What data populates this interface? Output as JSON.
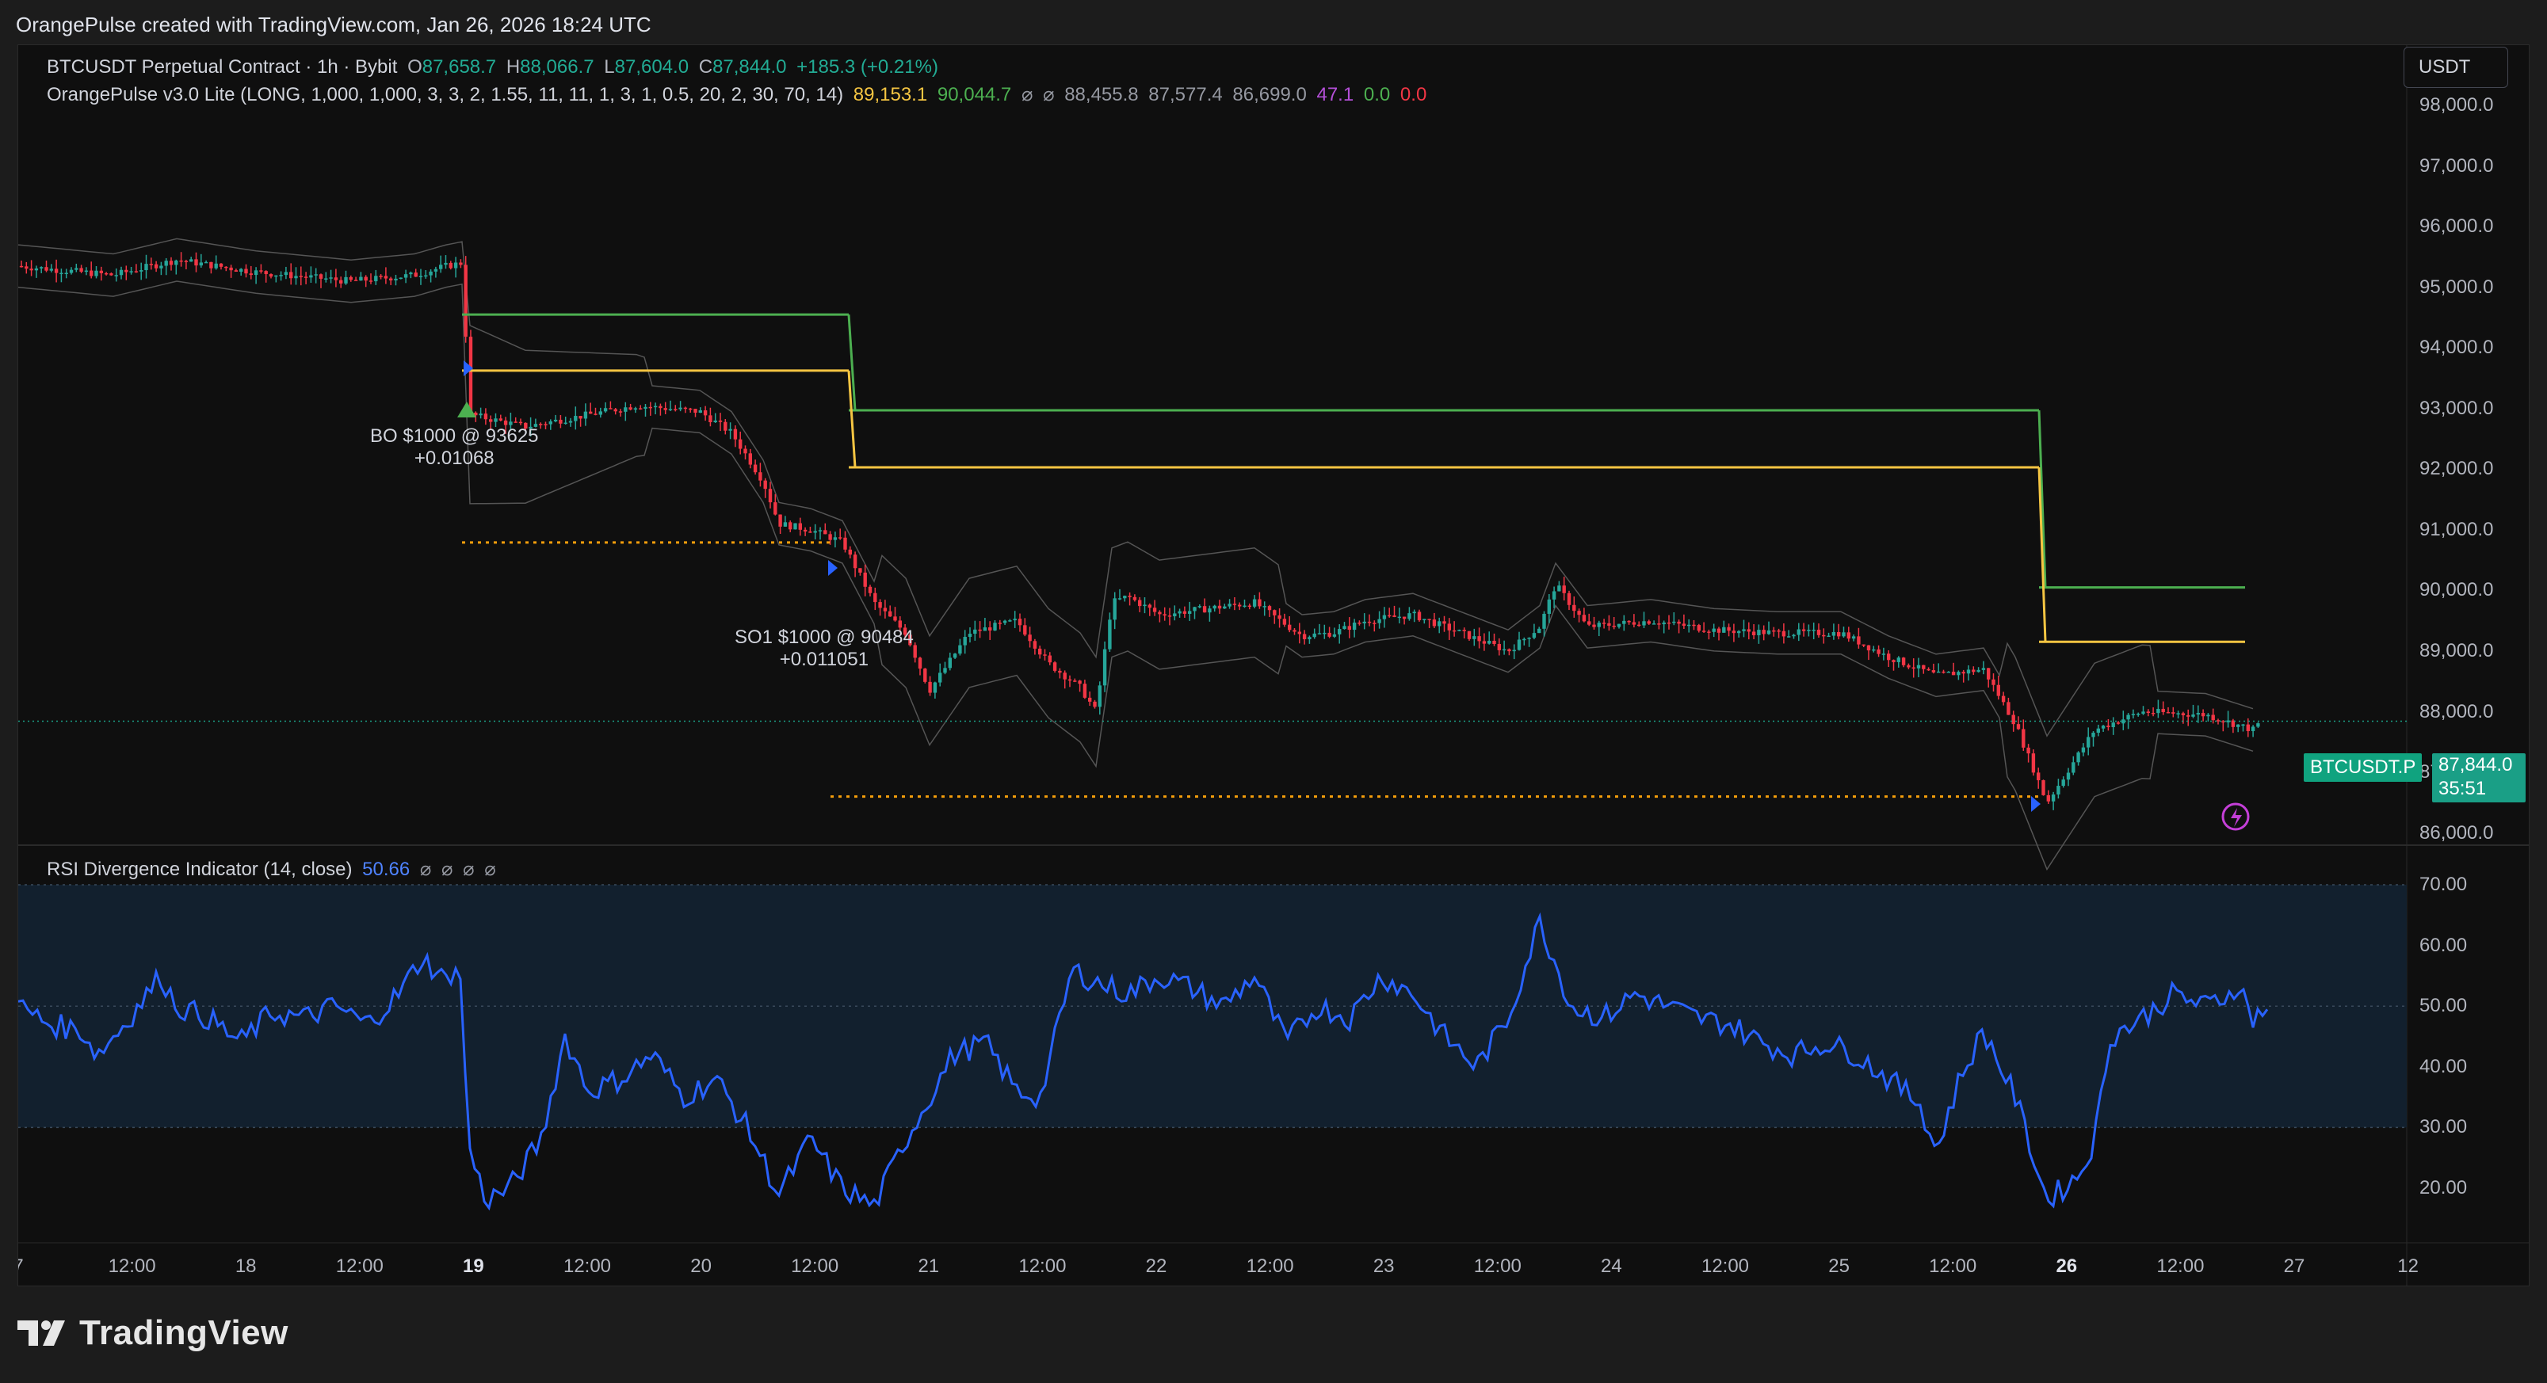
{
  "header": {
    "credit": "OrangePulse created with TradingView.com, Jan 26, 2026 18:24 UTC"
  },
  "legend_main": {
    "symbol": "BTCUSDT Perpetual Contract · 1h · Bybit",
    "o_label": "O",
    "o": "87,658.7",
    "h_label": "H",
    "h": "88,066.7",
    "l_label": "L",
    "l": "87,604.0",
    "c_label": "C",
    "c": "87,844.0",
    "change": "+185.3 (+0.21%)"
  },
  "legend_indicator": {
    "name": "OrangePulse v3.0 Lite (LONG, 1,000, 1,000, 3, 3, 2, 1.55, 11, 11, 1, 3, 1, 0.5, 20, 2, 30, 70, 14)",
    "v1": "89,153.1",
    "v2": "90,044.7",
    "v3": "⌀",
    "v4": "⌀",
    "v5": "88,455.8",
    "v6": "87,577.4",
    "v7": "86,699.0",
    "v8": "47.1",
    "v9": "0.0",
    "v10": "0.0"
  },
  "legend_rsi": {
    "name": "RSI Divergence Indicator (14, close)",
    "value": "50.66",
    "n1": "⌀",
    "n2": "⌀",
    "n3": "⌀",
    "n4": "⌀"
  },
  "currency": "USDT",
  "price_axis": [
    "98,000.0",
    "97,000.0",
    "96,000.0",
    "95,000.0",
    "94,000.0",
    "93,000.0",
    "92,000.0",
    "91,000.0",
    "90,000.0",
    "89,000.0",
    "88,000.0",
    "87,000.0",
    "86,000.0"
  ],
  "rsi_axis": [
    "70.00",
    "60.00",
    "50.00",
    "40.00",
    "30.00",
    "20.00"
  ],
  "time_axis": [
    "7",
    "12:00",
    "18",
    "12:00",
    "19",
    "12:00",
    "20",
    "12:00",
    "21",
    "12:00",
    "22",
    "12:00",
    "23",
    "12:00",
    "24",
    "12:00",
    "25",
    "12:00",
    "26",
    "12:00",
    "27",
    "12"
  ],
  "last_price": {
    "symbol": "BTCUSDT.P",
    "price": "87,844.0",
    "countdown": "35:51"
  },
  "annotations": {
    "bo_line1": "BO $1000 @ 93625",
    "bo_line2": "+0.01068",
    "so_line1": "SO1 $1000 @ 90484",
    "so_line2": "+0.011051"
  },
  "colors": {
    "up": "#26a69a",
    "down": "#f23645",
    "tp_line": "#4caf50",
    "avg_line": "#f5c542",
    "so_line": "#f59e0b",
    "rsi": "#2962ff",
    "bands": "#555555"
  },
  "chart_data": [
    {
      "type": "candlestick",
      "title": "BTCUSDT Perpetual Contract · 1h · Bybit",
      "ylim": [
        86000,
        98000
      ],
      "xlabel": "",
      "ylabel": "",
      "key_levels": {
        "take_profit": [
          {
            "from": "19",
            "to": "20 12:00",
            "y": 94550
          },
          {
            "from": "20 12:00",
            "to": "25 12:00",
            "y": 92970
          },
          {
            "from": "25 12:00",
            "to": "26 12:00",
            "y": 90050
          }
        ],
        "average_entry": [
          {
            "from": "19",
            "to": "20 12:00",
            "y": 93625
          },
          {
            "from": "20 12:00",
            "to": "25 12:00",
            "y": 92030
          },
          {
            "from": "25 12:00",
            "to": "26 12:00",
            "y": 89153
          }
        ],
        "safety_order": [
          {
            "from": "19",
            "to": "20 12:00",
            "y": 90790
          },
          {
            "from": "20 12:00",
            "to": "25 12:00",
            "y": 86600
          }
        ]
      },
      "last_close": 87844
    },
    {
      "type": "line",
      "title": "RSI Divergence Indicator (14, close)",
      "ylim": [
        15,
        72
      ],
      "bands": [
        30,
        70
      ],
      "last_value": 50.66
    }
  ]
}
